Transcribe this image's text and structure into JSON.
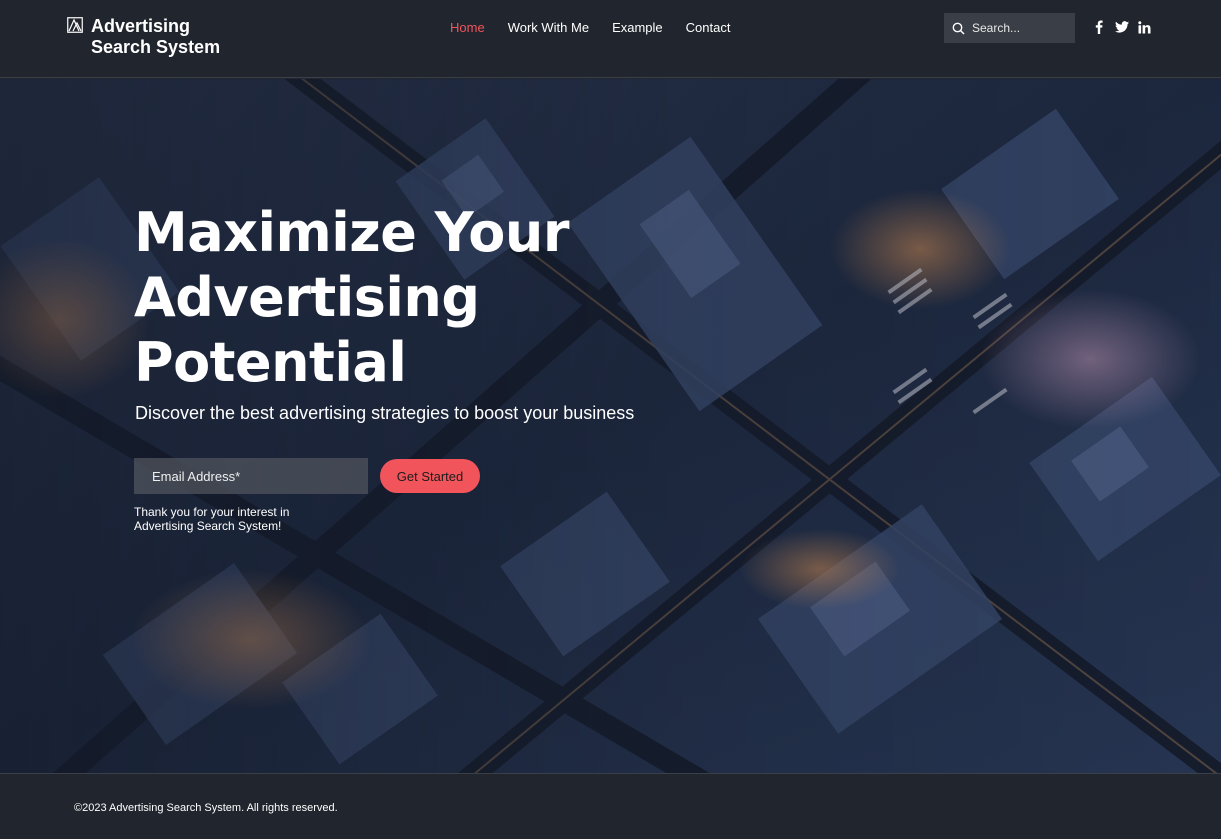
{
  "brand": {
    "line1": "Advertising",
    "line2": "Search System",
    "icon": "triangle-logo-icon"
  },
  "nav": {
    "items": [
      {
        "label": "Home",
        "active": true
      },
      {
        "label": "Work With Me",
        "active": false
      },
      {
        "label": "Example",
        "active": false
      },
      {
        "label": "Contact",
        "active": false
      }
    ]
  },
  "search": {
    "placeholder": "Search...",
    "icon": "search-icon"
  },
  "socials": [
    "facebook-icon",
    "twitter-icon",
    "linkedin-icon"
  ],
  "hero": {
    "title": "Maximize Your Advertising Potential",
    "subtitle": "Discover the best advertising strategies to boost your business",
    "email_placeholder": "Email Address*",
    "cta_label": "Get Started",
    "thanks": "Thank you for your interest in Advertising Search System!",
    "background": "aerial-city-night-photo"
  },
  "footer": {
    "copyright": "©2023 Advertising Search System. All rights reserved."
  },
  "colors": {
    "accent": "#f2545b",
    "background": "#21252d",
    "text": "#ffffff"
  }
}
